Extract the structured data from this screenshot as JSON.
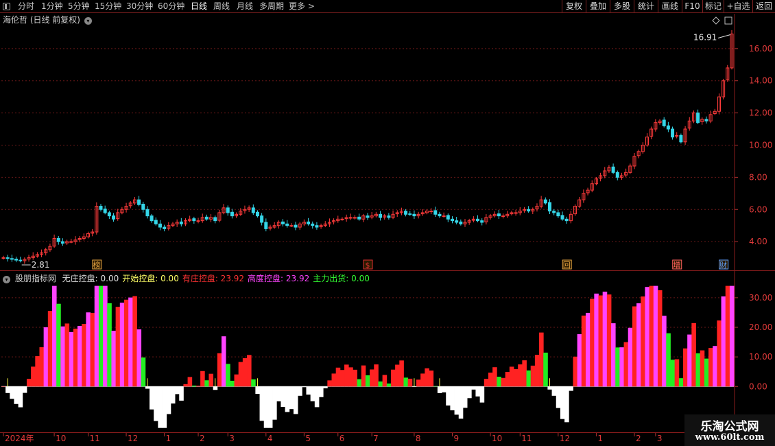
{
  "toolbar": {
    "periods": [
      "分时",
      "1分钟",
      "5分钟",
      "15分钟",
      "30分钟",
      "60分钟",
      "日线",
      "周线",
      "月线",
      "多周期",
      "更多 >"
    ],
    "active": "日线",
    "right": [
      "复权",
      "叠加",
      "多股",
      "统计",
      "画线",
      "F10",
      "标记",
      "+自选",
      "返回"
    ]
  },
  "main_title": "海伦哲 (日线 前复权)",
  "max_price_label": "16.91",
  "min_price_label": "2.81",
  "event_labels": [
    {
      "text": "榜",
      "x_index": 22,
      "color": "#e0a040"
    },
    {
      "text": "$",
      "x_index": 86,
      "color": "#e03030"
    },
    {
      "text": "回",
      "x_index": 133,
      "color": "#e0a040"
    },
    {
      "text": "增",
      "x_index": 159,
      "color": "#ff6060"
    },
    {
      "text": "财",
      "x_index": 170,
      "color": "#60a0ff"
    }
  ],
  "indicator": {
    "name": "股朋指标网",
    "items": [
      {
        "label": "无庄控盘:",
        "value": "0.00",
        "color": "#e0e0e0"
      },
      {
        "label": "开始控盘:",
        "value": "0.00",
        "color": "#ffff66"
      },
      {
        "label": "有庄控盘:",
        "value": "23.92",
        "color": "#ff3333"
      },
      {
        "label": "高度控盘:",
        "value": "23.92",
        "color": "#ff44ff"
      },
      {
        "label": "主力出货:",
        "value": "0.00",
        "color": "#33ff33"
      }
    ]
  },
  "x_axis": {
    "labels": [
      {
        "text": "2024年",
        "i": 0
      },
      {
        "text": "10",
        "i": 12
      },
      {
        "text": "11",
        "i": 20
      },
      {
        "text": "12",
        "i": 29
      },
      {
        "text": "1",
        "i": 38
      },
      {
        "text": "2",
        "i": 46
      },
      {
        "text": "3",
        "i": 53
      },
      {
        "text": "4",
        "i": 62
      },
      {
        "text": "5",
        "i": 71
      },
      {
        "text": "6",
        "i": 79
      },
      {
        "text": "7",
        "i": 87
      },
      {
        "text": "8",
        "i": 97
      },
      {
        "text": "9",
        "i": 106
      },
      {
        "text": "10",
        "i": 115
      },
      {
        "text": "11",
        "i": 122
      },
      {
        "text": "12",
        "i": 131
      },
      {
        "text": "1",
        "i": 140
      },
      {
        "text": "2",
        "i": 149
      },
      {
        "text": "3",
        "i": 154
      }
    ]
  },
  "watermark": {
    "title": "乐淘公式网",
    "url": "www.60lt.com"
  },
  "chart_data": [
    {
      "type": "candlestick",
      "title": "海伦哲 (日线 前复权)",
      "y_ticks": [
        4.0,
        6.0,
        8.0,
        10.0,
        12.0,
        14.0,
        16.0
      ],
      "ylim": [
        2.3,
        17.4
      ],
      "close": [
        3.0,
        2.95,
        2.9,
        2.85,
        2.81,
        2.9,
        3.0,
        3.1,
        3.2,
        3.3,
        3.5,
        3.7,
        4.2,
        4.0,
        3.9,
        4.0,
        4.0,
        4.1,
        4.2,
        4.3,
        4.5,
        4.6,
        6.2,
        6.0,
        5.8,
        5.6,
        5.4,
        5.8,
        6.0,
        6.2,
        6.4,
        6.6,
        6.3,
        6.0,
        5.6,
        5.3,
        5.1,
        4.9,
        4.8,
        5.0,
        5.1,
        5.2,
        5.1,
        5.3,
        5.4,
        5.3,
        5.3,
        5.5,
        5.4,
        5.5,
        5.3,
        5.8,
        6.1,
        5.8,
        5.6,
        5.7,
        5.9,
        6.0,
        6.1,
        5.8,
        5.6,
        5.2,
        4.8,
        4.9,
        5.0,
        5.2,
        5.1,
        5.0,
        5.0,
        4.9,
        5.1,
        5.2,
        5.1,
        5.0,
        4.9,
        5.0,
        5.1,
        5.2,
        5.3,
        5.4,
        5.4,
        5.5,
        5.5,
        5.5,
        5.4,
        5.6,
        5.5,
        5.6,
        5.7,
        5.5,
        5.6,
        5.5,
        5.7,
        5.8,
        5.9,
        5.7,
        5.7,
        5.6,
        5.7,
        5.8,
        5.9,
        5.9,
        5.7,
        5.6,
        5.6,
        5.4,
        5.3,
        5.2,
        5.1,
        5.2,
        5.3,
        5.4,
        5.3,
        5.2,
        5.5,
        5.6,
        5.7,
        5.6,
        5.6,
        5.7,
        5.8,
        5.8,
        5.9,
        6.0,
        5.9,
        6.0,
        6.2,
        6.6,
        6.4,
        5.9,
        5.8,
        5.6,
        5.4,
        5.3,
        5.7,
        6.2,
        6.6,
        7.0,
        7.2,
        7.6,
        7.9,
        8.1,
        8.4,
        8.6,
        8.3,
        8.0,
        8.1,
        8.3,
        8.7,
        9.3,
        9.6,
        10.0,
        10.5,
        11.0,
        11.4,
        11.5,
        11.2,
        11.0,
        10.5,
        10.6,
        10.2,
        11.0,
        11.5,
        12.0,
        11.4,
        11.6,
        11.5,
        11.9,
        12.1,
        13.0,
        14.0,
        14.8,
        16.91
      ],
      "indicators": [
        "无庄控盘",
        "开始控盘",
        "有庄控盘",
        "高度控盘",
        "主力出货"
      ],
      "indicator_y_ticks": [
        0.0,
        10.0,
        20.0,
        30.0
      ],
      "indicator_ylim": [
        -15,
        36
      ]
    }
  ]
}
